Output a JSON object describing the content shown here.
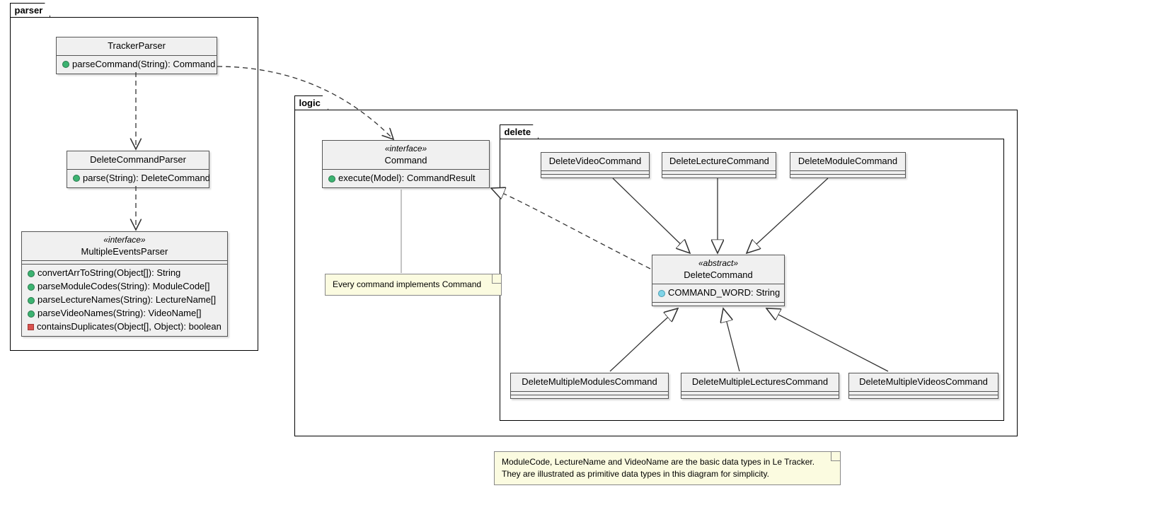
{
  "packages": {
    "parser": "parser",
    "logic": "logic",
    "delete": "delete"
  },
  "classes": {
    "trackerParser": {
      "name": "TrackerParser",
      "methods": [
        "parseCommand(String): Command"
      ]
    },
    "deleteCommandParser": {
      "name": "DeleteCommandParser",
      "methods": [
        "parse(String): DeleteCommand"
      ]
    },
    "multipleEventsParser": {
      "stereotype": "«interface»",
      "name": "MultipleEventsParser",
      "methods": [
        {
          "vis": "green",
          "sig": "convertArrToString(Object[]): String"
        },
        {
          "vis": "green",
          "sig": "parseModuleCodes(String): ModuleCode[]"
        },
        {
          "vis": "green",
          "sig": "parseLectureNames(String): LectureName[]"
        },
        {
          "vis": "green",
          "sig": "parseVideoNames(String): VideoName[]"
        },
        {
          "vis": "red",
          "sig": "containsDuplicates(Object[], Object): boolean"
        }
      ]
    },
    "command": {
      "stereotype": "«interface»",
      "name": "Command",
      "methods": [
        "execute(Model): CommandResult"
      ]
    },
    "deleteVideoCommand": {
      "name": "DeleteVideoCommand"
    },
    "deleteLectureCommand": {
      "name": "DeleteLectureCommand"
    },
    "deleteModuleCommand": {
      "name": "DeleteModuleCommand"
    },
    "deleteCommand": {
      "stereotype": "«abstract»",
      "name": "DeleteCommand",
      "attrs": [
        "COMMAND_WORD: String"
      ]
    },
    "deleteMultipleModulesCommand": {
      "name": "DeleteMultipleModulesCommand"
    },
    "deleteMultipleLecturesCommand": {
      "name": "DeleteMultipleLecturesCommand"
    },
    "deleteMultipleVideosCommand": {
      "name": "DeleteMultipleVideosCommand"
    }
  },
  "notes": {
    "commandNote": "Every command implements Command",
    "bottomNote1": "ModuleCode, LectureName and VideoName are the basic data types in Le Tracker.",
    "bottomNote2": "They are illustrated as primitive data types in this diagram for simplicity."
  }
}
